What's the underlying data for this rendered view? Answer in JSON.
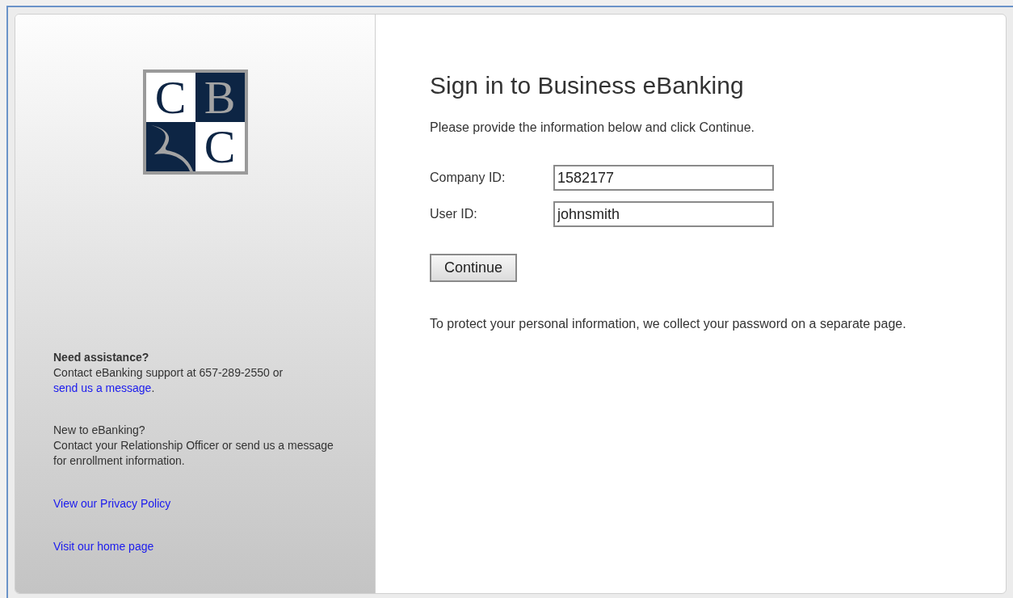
{
  "logo": {
    "letters": [
      "C",
      "B",
      "C"
    ]
  },
  "assistance": {
    "heading": "Need assistance?",
    "text": "Contact eBanking support at 657-289-2550 or",
    "link": "send us a message",
    "after": "."
  },
  "enrollment": {
    "heading": "New to eBanking?",
    "text": "Contact your Relationship Officer or send us a message for enrollment information."
  },
  "links": [
    "View our Privacy Policy",
    "Visit our home page"
  ],
  "form": {
    "title": "Sign in to Business eBanking",
    "instructions": "Please provide the information below and click Continue.",
    "fields": [
      {
        "label": "Company ID:",
        "value": "1582177"
      },
      {
        "label": "User ID:",
        "value": "johnsmith"
      }
    ],
    "button": "Continue",
    "note": "To protect your personal information, we collect your password on a separate page."
  }
}
